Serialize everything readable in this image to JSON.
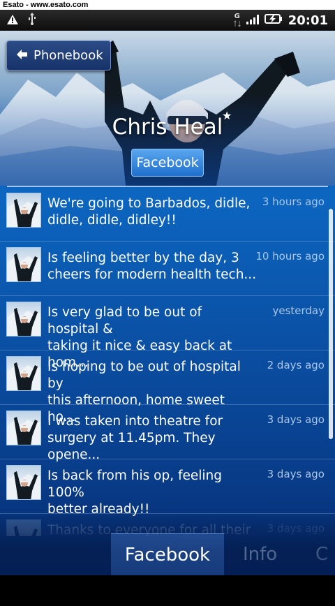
{
  "watermark": "Esato - www.esato.com",
  "status_bar": {
    "left_icons": [
      "warning-icon",
      "usb-icon"
    ],
    "network_label": "G",
    "right_icons": [
      "signal-icon",
      "battery-charging-icon"
    ],
    "time": "20:01"
  },
  "header": {
    "back_label": "Phonebook",
    "contact_name": "Chris Heal",
    "favorite": "★",
    "service_badge": "Facebook"
  },
  "posts": [
    {
      "text_line1": "We're going to Barbados, didle,",
      "text_line2": "didle, didle, didley!!",
      "time": "3 hours ago"
    },
    {
      "text_line1": "Is feeling better by the day, 3",
      "text_line2": "cheers for modern health tech...",
      "time": "10 hours ago"
    },
    {
      "text_line1": "Is very glad to be out of hospital &",
      "text_line2": "taking it nice & easy back at hom...",
      "time": "yesterday"
    },
    {
      "text_line1": "Is hoping to be out of hospital by",
      "text_line2": "this afternoon, home sweet ho...",
      "time": "2 days ago"
    },
    {
      "text_line1": "I was taken into theatre for",
      "text_line2": "surgery at 11.45pm. They opene...",
      "time": "3 days ago"
    },
    {
      "text_line1": "Is back from his op, feeling 100%",
      "text_line2": "better already!!",
      "time": "3 days ago"
    },
    {
      "text_line1": "Thanks to everyone for all their",
      "text_line2": "",
      "time": "3 days ago"
    }
  ],
  "tabs": {
    "active": "Facebook",
    "second": "Info",
    "third": "C"
  },
  "colors": {
    "background_top": "#0c66c0",
    "background_bottom": "#04205a",
    "timestamp": "#a9c6ea",
    "badge": "#1f6fcd"
  }
}
